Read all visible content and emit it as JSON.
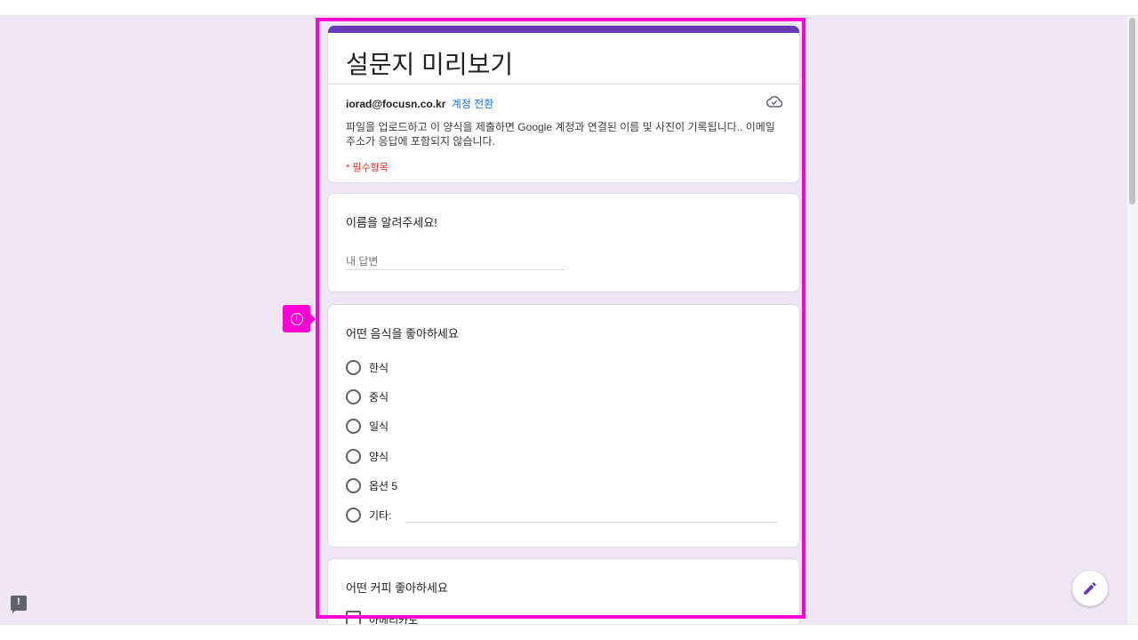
{
  "form": {
    "title": "설문지 미리보기",
    "account_email": "iorad@focusn.co.kr",
    "switch_account": "계정 전환",
    "cloud_icon": "cloud-done-icon",
    "notice": "파일을 업로드하고 이 양식을 제출하면 Google 계정과 연결된 이름 및 사진이 기록됩니다.. 이메일 주소가 응답에 포함되지 않습니다.",
    "required_note": "* 필수항목"
  },
  "questions": [
    {
      "title": "이름을 알려주세요!",
      "answer_placeholder": "내 답변"
    },
    {
      "title": "어떤 음식을 좋아하세요",
      "options": [
        "한식",
        "중식",
        "일식",
        "양식",
        "옵션 5",
        "기타:"
      ]
    },
    {
      "title": "어떤 커피 좋아하세요",
      "options": [
        "아메리카노"
      ]
    }
  ],
  "colors": {
    "accent": "#673ab7",
    "background": "#efe7f6",
    "link": "#1a73e8",
    "required": "#d93025",
    "highlight": "#ff00d4"
  },
  "icons": {
    "tag": "info-icon",
    "feedback": "feedback-icon",
    "fab": "edit-pencil-icon"
  }
}
